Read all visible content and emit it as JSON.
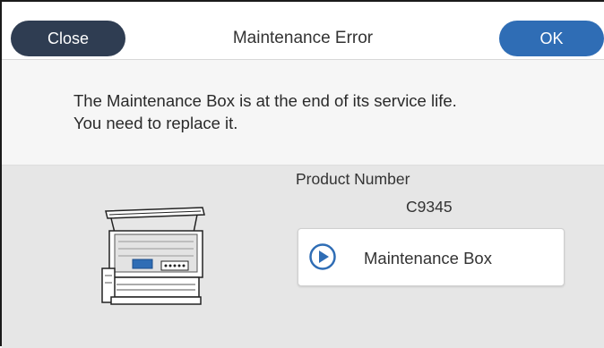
{
  "header": {
    "close_label": "Close",
    "title": "Maintenance Error",
    "ok_label": "OK"
  },
  "message": {
    "line1": "The Maintenance Box is at the end of its service life.",
    "line2": "You need to replace it."
  },
  "product": {
    "number_label": "Product Number",
    "number_value": "C9345"
  },
  "maintenance_button": {
    "label": "Maintenance Box",
    "icon": "play-circle-icon"
  },
  "illustration": {
    "icon": "printer-illustration"
  },
  "colors": {
    "close_button": "#2f3d52",
    "ok_button": "#2f6db5",
    "play_icon": "#2f6db5",
    "lower_panel": "#e6e6e6"
  }
}
